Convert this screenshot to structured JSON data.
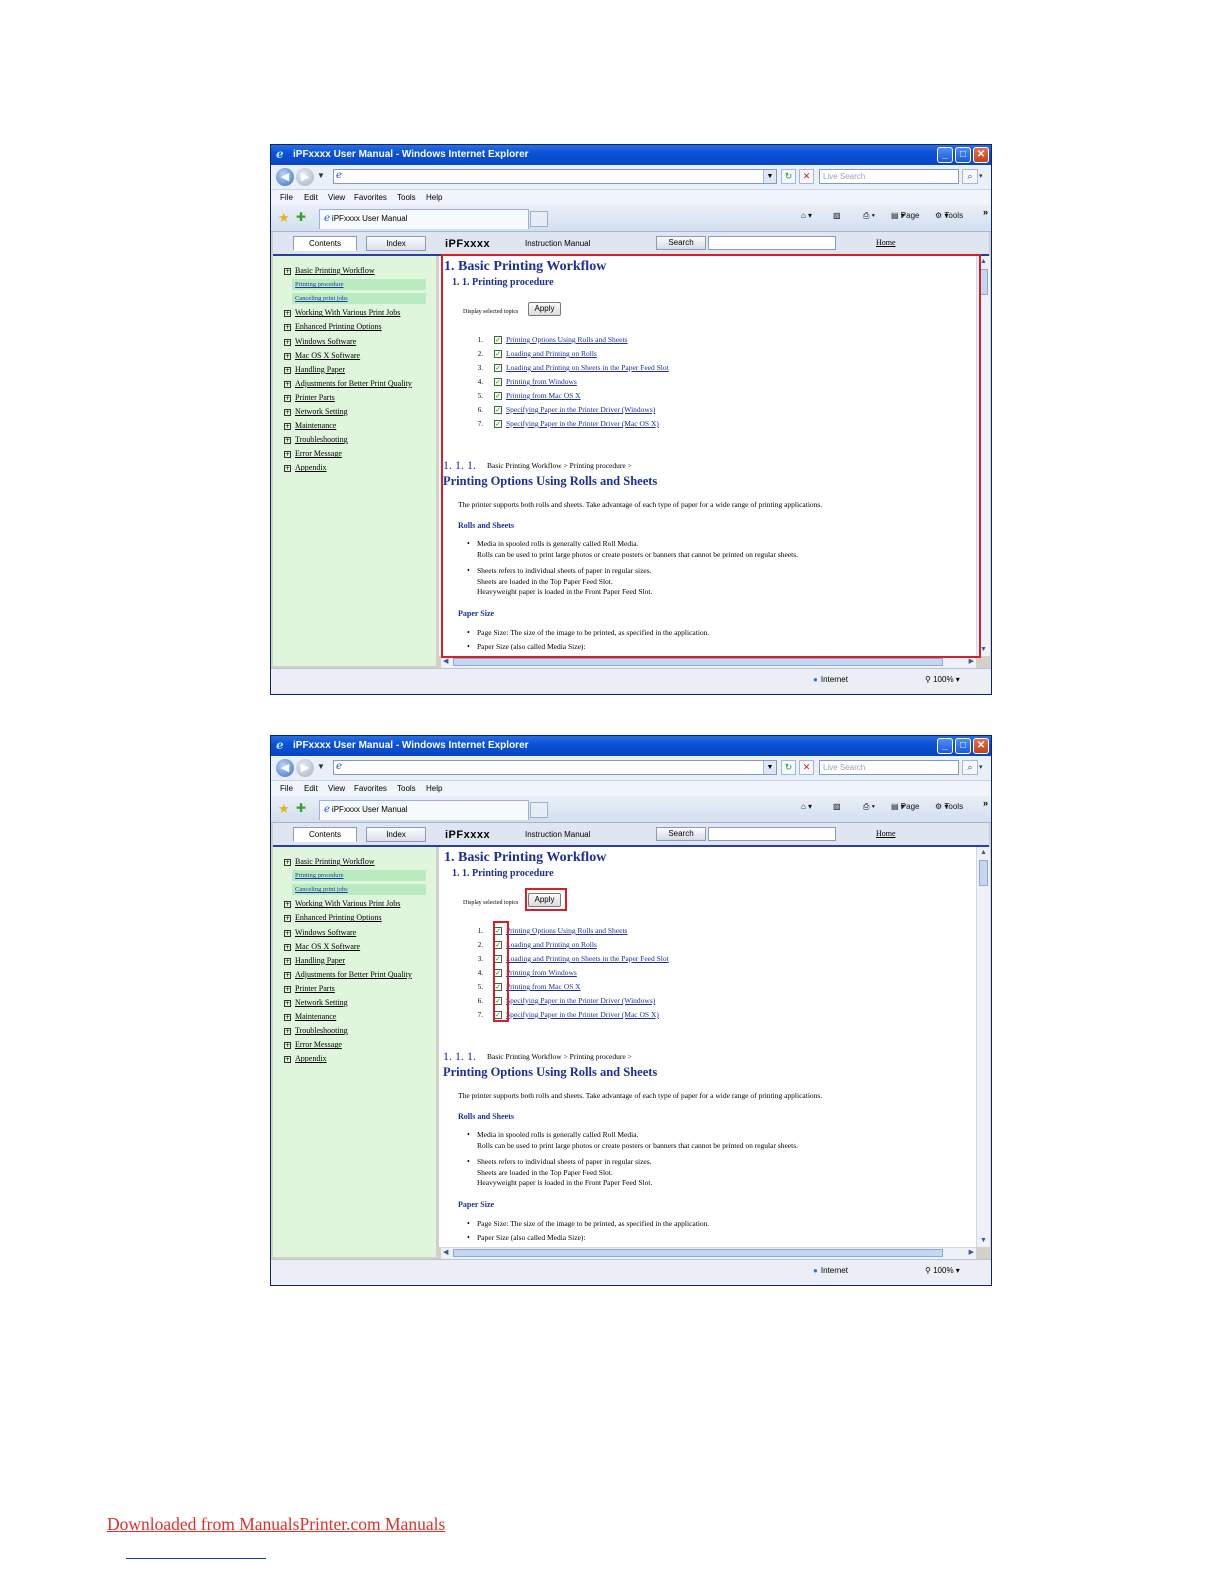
{
  "browser": {
    "window_title": "iPFxxxx User Manual - Windows Internet Explorer",
    "live_search_placeholder": "Live Search",
    "menu": [
      "File",
      "Edit",
      "View",
      "Favorites",
      "Tools",
      "Help"
    ],
    "tab_title": "iPFxxxx User Manual",
    "command_bar": {
      "page": "Page",
      "tools": "Tools"
    },
    "status": {
      "zone": "Internet",
      "zoom": "100%"
    }
  },
  "manual_header": {
    "contents_tab": "Contents",
    "index_tab": "Index",
    "brand": "iPFxxxx",
    "subtitle": "Instruction Manual",
    "search_button": "Search",
    "home_link": "Home"
  },
  "sidebar": {
    "items": [
      {
        "label": "Basic Printing Workflow",
        "type": "section"
      },
      {
        "label": "Printing procedure",
        "type": "sub",
        "selected": true
      },
      {
        "label": "Canceling print jobs",
        "type": "sub",
        "selected": true
      },
      {
        "label": "Working With Various Print Jobs",
        "type": "section"
      },
      {
        "label": "Enhanced Printing Options",
        "type": "section"
      },
      {
        "label": "Windows Software",
        "type": "section"
      },
      {
        "label": "Mac OS X Software",
        "type": "section"
      },
      {
        "label": "Handling Paper",
        "type": "section"
      },
      {
        "label": "Adjustments for Better Print Quality",
        "type": "section"
      },
      {
        "label": "Printer Parts",
        "type": "section"
      },
      {
        "label": "Network Setting",
        "type": "section"
      },
      {
        "label": "Maintenance",
        "type": "section"
      },
      {
        "label": "Troubleshooting",
        "type": "section"
      },
      {
        "label": "Error Message",
        "type": "section"
      },
      {
        "label": "Appendix",
        "type": "section"
      }
    ]
  },
  "content": {
    "h1": "1. Basic Printing Workflow",
    "h2": "1. 1. Printing procedure",
    "display_selected": "Display selected topics",
    "apply_button": "Apply",
    "topics": [
      {
        "num": "1.",
        "label": "Printing Options Using Rolls and Sheets",
        "checked": true
      },
      {
        "num": "2.",
        "label": "Loading and Printing on Rolls",
        "checked": true
      },
      {
        "num": "3.",
        "label": "Loading and Printing on Sheets in the Paper Feed Slot",
        "checked": true
      },
      {
        "num": "4.",
        "label": "Printing from Windows",
        "checked": true
      },
      {
        "num": "5.",
        "label": "Printing from Mac OS X",
        "checked": true
      },
      {
        "num": "6.",
        "label": "Specifying Paper in the Printer Driver (Windows)",
        "checked": true
      },
      {
        "num": "7.",
        "label": "Specifying Paper in the Printer Driver (Mac OS X)",
        "checked": true
      }
    ],
    "section_number": "1. 1. 1.",
    "breadcrumb": "Basic Printing Workflow > Printing procedure >",
    "h3": "Printing Options Using Rolls and Sheets",
    "intro": "The printer supports both rolls and sheets. Take advantage of each type of paper for a wide range of printing applications.",
    "rolls_heading": "Rolls and Sheets",
    "rolls_bullets": [
      [
        "Media in spooled rolls is generally called Roll Media.",
        "Rolls can be used to print large photos or create posters or banners that cannot be printed on regular sheets."
      ],
      [
        "Sheets refers to individual sheets of paper in regular sizes.",
        "Sheets are loaded in the Top Paper Feed Slot.",
        "Heavyweight paper is loaded in the Front Paper Feed Slot."
      ]
    ],
    "size_heading": "Paper Size",
    "size_bullets": [
      [
        "Page Size: The size of the image to be printed, as specified in the application."
      ],
      [
        "Paper Size (also called Media Size):"
      ]
    ]
  },
  "footer": {
    "link": "Downloaded from ManualsPrinter.com Manuals"
  },
  "highlight_color": "#d81e2a"
}
